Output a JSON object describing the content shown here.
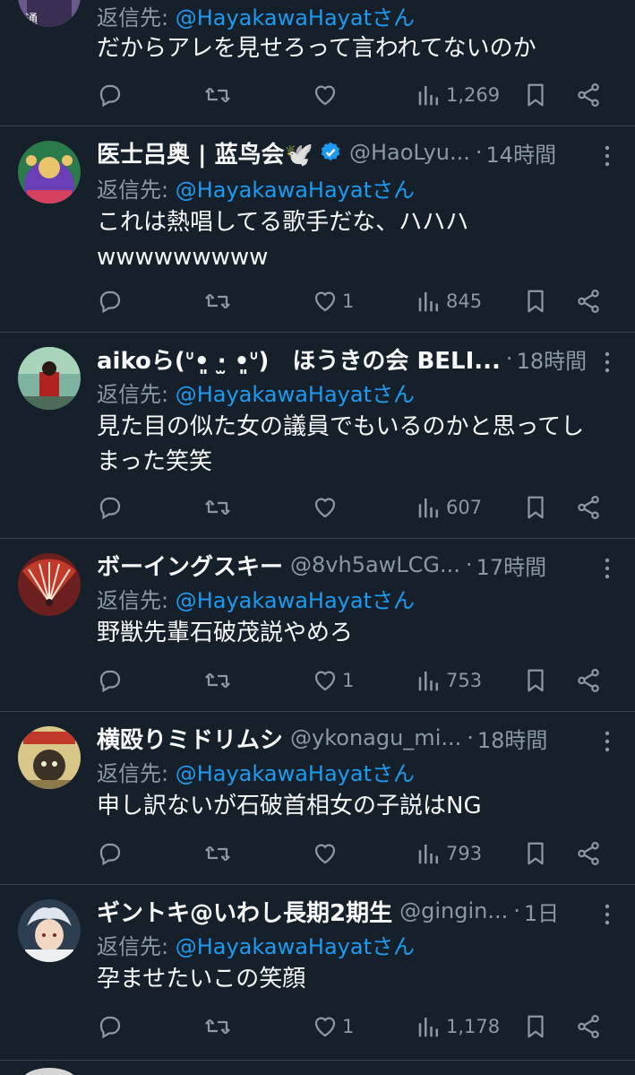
{
  "reply_prefix": "返信先: ",
  "colors": {
    "background": "#15202b",
    "text": "#f7f9f9",
    "muted": "#8b98a5",
    "link": "#1d9bf0",
    "divider": "#38444d",
    "verified": "#1d9bf0"
  },
  "tweets": [
    {
      "name": "",
      "handle": "",
      "time": "",
      "reply_to": "@HayakawaHayatさん",
      "text_lines": [
        "だからアレを見せろって言われてないのか"
      ],
      "replies": "",
      "retweets": "",
      "likes": "",
      "views": "1,269"
    },
    {
      "name": "医士吕奥 | 蓝鸟会🕊️",
      "handle": "@HaoLyu...",
      "time": "14時間",
      "verified": true,
      "reply_to": "@HayakawaHayatさん",
      "text_lines": [
        "これは熱唱してる歌手だな、ハハハ",
        "wwwwwwwww"
      ],
      "replies": "",
      "retweets": "",
      "likes": "1",
      "views": "845"
    },
    {
      "name": "aikoら(ᐡ•͈ ·̫ •͈ᐡ)　ほうきの会 BELI...",
      "handle": "",
      "time": "18時間",
      "reply_to": "@HayakawaHayatさん",
      "text_lines": [
        "見た目の似た女の議員でもいるのかと思ってし",
        "まった笑笑"
      ],
      "replies": "",
      "retweets": "",
      "likes": "",
      "views": "607"
    },
    {
      "name": "ボーイングスキー",
      "handle": "@8vh5awLCG...",
      "time": "17時間",
      "reply_to": "@HayakawaHayatさん",
      "text_lines": [
        "野獣先輩石破茂説やめろ"
      ],
      "replies": "",
      "retweets": "",
      "likes": "1",
      "views": "753"
    },
    {
      "name": "横殴りミドリムシ",
      "handle": "@ykonagu_mi...",
      "time": "18時間",
      "reply_to": "@HayakawaHayatさん",
      "text_lines": [
        "申し訳ないが石破首相女の子説はNG"
      ],
      "replies": "",
      "retweets": "",
      "likes": "",
      "views": "793"
    },
    {
      "name": "ギントキ@いわし長期2期生",
      "handle": "@gingin...",
      "time": "1日",
      "reply_to": "@HayakawaHayatさん",
      "text_lines": [
        "孕ませたいこの笑顔"
      ],
      "replies": "",
      "retweets": "",
      "likes": "1",
      "views": "1,178"
    }
  ]
}
